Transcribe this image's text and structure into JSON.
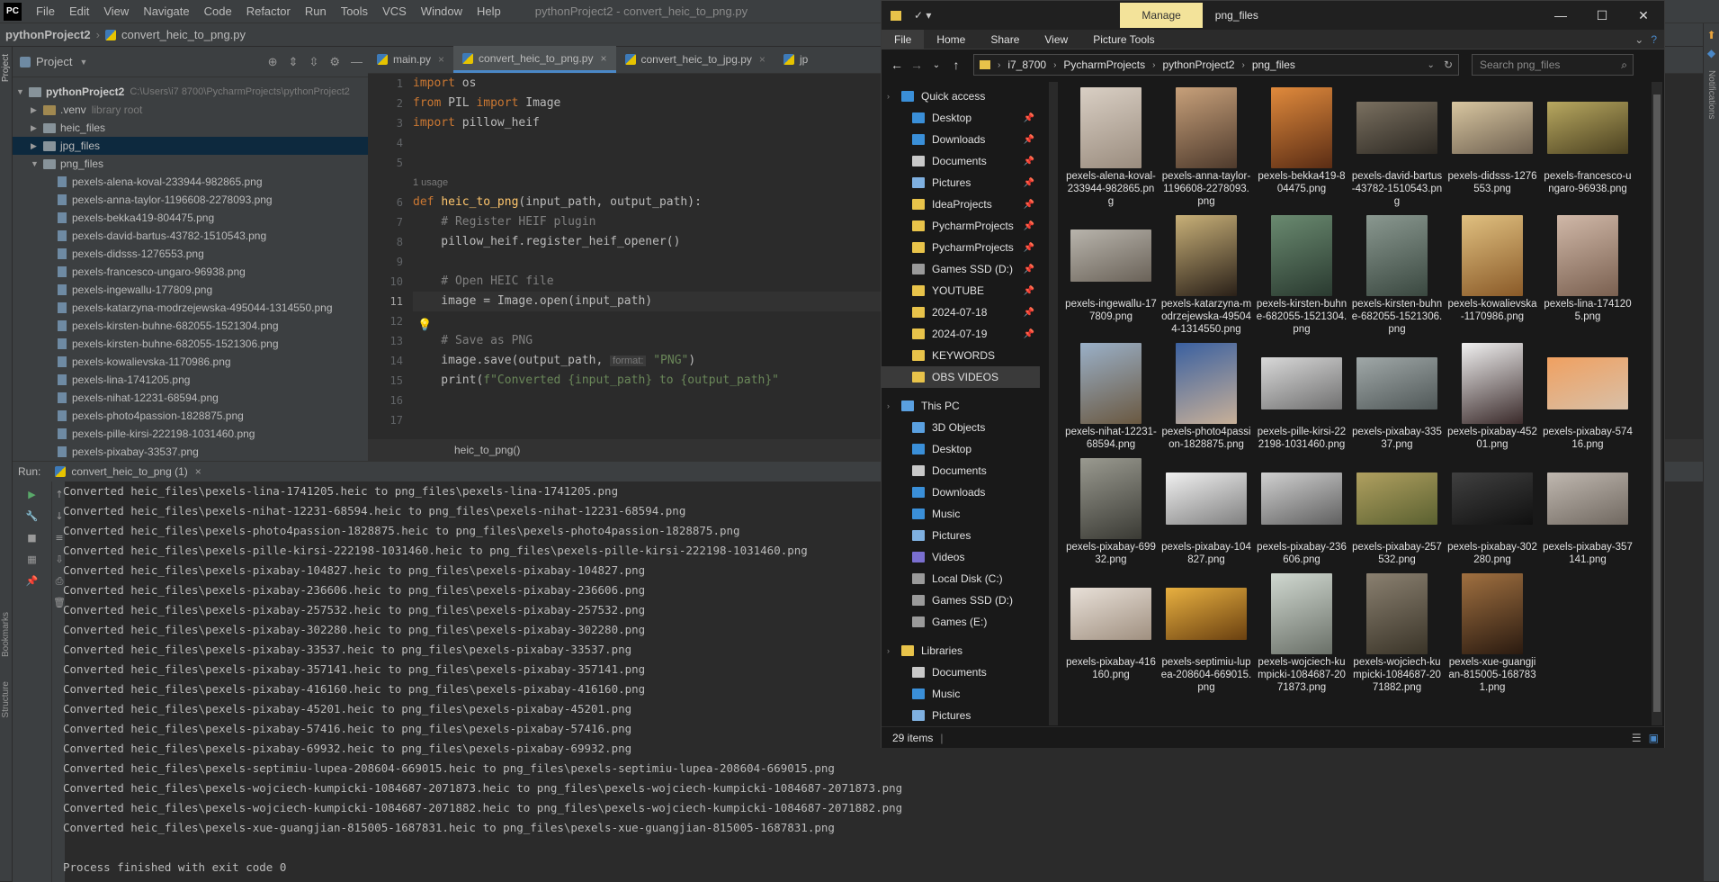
{
  "ide": {
    "logo": "PC",
    "menu": [
      "File",
      "Edit",
      "View",
      "Navigate",
      "Code",
      "Refactor",
      "Run",
      "Tools",
      "VCS",
      "Window",
      "Help"
    ],
    "window_title": "pythonProject2 - convert_heic_to_png.py",
    "breadcrumb": [
      "pythonProject2",
      "convert_heic_to_png.py"
    ],
    "project_panel": {
      "title": "Project",
      "root": "pythonProject2",
      "root_path": "C:\\Users\\i7 8700\\PycharmProjects\\pythonProject2",
      "folders": [
        {
          "name": ".venv",
          "hint": "library root"
        },
        {
          "name": "heic_files",
          "hint": ""
        },
        {
          "name": "jpg_files",
          "hint": ""
        },
        {
          "name": "png_files",
          "hint": ""
        }
      ],
      "files": [
        "pexels-alena-koval-233944-982865.png",
        "pexels-anna-taylor-1196608-2278093.png",
        "pexels-bekka419-804475.png",
        "pexels-david-bartus-43782-1510543.png",
        "pexels-didsss-1276553.png",
        "pexels-francesco-ungaro-96938.png",
        "pexels-ingewallu-177809.png",
        "pexels-katarzyna-modrzejewska-495044-1314550.png",
        "pexels-kirsten-buhne-682055-1521304.png",
        "pexels-kirsten-buhne-682055-1521306.png",
        "pexels-kowalievska-1170986.png",
        "pexels-lina-1741205.png",
        "pexels-nihat-12231-68594.png",
        "pexels-photo4passion-1828875.png",
        "pexels-pille-kirsi-222198-1031460.png",
        "pexels-pixabay-33537.png"
      ]
    },
    "editor": {
      "tabs": [
        "main.py",
        "convert_heic_to_png.py",
        "convert_heic_to_jpg.py",
        "jp"
      ],
      "line_numbers": [
        "1",
        "2",
        "3",
        "4",
        "5",
        "6",
        "7",
        "8",
        "9",
        "10",
        "11",
        "12",
        "13",
        "14",
        "15",
        "16",
        "17"
      ],
      "code": {
        "l1_kw": "import",
        "l1_rest": " os",
        "l2_kw1": "from",
        "l2_mid": " PIL ",
        "l2_kw2": "import",
        "l2_rest": " Image",
        "l3_kw": "import",
        "l3_rest": " pillow_heif",
        "usage": "1 usage",
        "l6_kw": "def",
        "l6_fn": "heic_to_png",
        "l6_rest": "(input_path, output_path):",
        "l7": "    # Register HEIF plugin",
        "l8": "    pillow_heif.register_heif_opener()",
        "l10": "    # Open HEIC file",
        "l11": "    image = Image.open(input_path)",
        "l13": "    # Save as PNG",
        "l14_a": "    image.save(output_path, ",
        "l14_hint": "format:",
        "l14_str": " \"PNG\"",
        "l14_end": ")",
        "l15_a": "    print(",
        "l15_str": "f\"Converted {input_path} to {output_path}\""
      },
      "footer_crumb": "heic_to_png()"
    },
    "run": {
      "label": "Run:",
      "tab": "convert_heic_to_png (1)",
      "lines": [
        "Converted heic_files\\pexels-lina-1741205.heic to png_files\\pexels-lina-1741205.png",
        "Converted heic_files\\pexels-nihat-12231-68594.heic to png_files\\pexels-nihat-12231-68594.png",
        "Converted heic_files\\pexels-photo4passion-1828875.heic to png_files\\pexels-photo4passion-1828875.png",
        "Converted heic_files\\pexels-pille-kirsi-222198-1031460.heic to png_files\\pexels-pille-kirsi-222198-1031460.png",
        "Converted heic_files\\pexels-pixabay-104827.heic to png_files\\pexels-pixabay-104827.png",
        "Converted heic_files\\pexels-pixabay-236606.heic to png_files\\pexels-pixabay-236606.png",
        "Converted heic_files\\pexels-pixabay-257532.heic to png_files\\pexels-pixabay-257532.png",
        "Converted heic_files\\pexels-pixabay-302280.heic to png_files\\pexels-pixabay-302280.png",
        "Converted heic_files\\pexels-pixabay-33537.heic to png_files\\pexels-pixabay-33537.png",
        "Converted heic_files\\pexels-pixabay-357141.heic to png_files\\pexels-pixabay-357141.png",
        "Converted heic_files\\pexels-pixabay-416160.heic to png_files\\pexels-pixabay-416160.png",
        "Converted heic_files\\pexels-pixabay-45201.heic to png_files\\pexels-pixabay-45201.png",
        "Converted heic_files\\pexels-pixabay-57416.heic to png_files\\pexels-pixabay-57416.png",
        "Converted heic_files\\pexels-pixabay-69932.heic to png_files\\pexels-pixabay-69932.png",
        "Converted heic_files\\pexels-septimiu-lupea-208604-669015.heic to png_files\\pexels-septimiu-lupea-208604-669015.png",
        "Converted heic_files\\pexels-wojciech-kumpicki-1084687-2071873.heic to png_files\\pexels-wojciech-kumpicki-1084687-2071873.png",
        "Converted heic_files\\pexels-wojciech-kumpicki-1084687-2071882.heic to png_files\\pexels-wojciech-kumpicki-1084687-2071882.png",
        "Converted heic_files\\pexels-xue-guangjian-815005-1687831.heic to png_files\\pexels-xue-guangjian-815005-1687831.png",
        "",
        "Process finished with exit code 0"
      ]
    },
    "side_labels": {
      "project": "Project",
      "bookmarks": "Bookmarks",
      "structure": "Structure",
      "notifications": "Notifications"
    }
  },
  "explorer": {
    "manage": "Manage",
    "title": "png_files",
    "ribbon_tabs": [
      "File",
      "Home",
      "Share",
      "View",
      "Picture Tools"
    ],
    "address": [
      "i7_8700",
      "PycharmProjects",
      "pythonProject2",
      "png_files"
    ],
    "search_placeholder": "Search png_files",
    "nav": {
      "quick_access": "Quick access",
      "quick_items": [
        "Desktop",
        "Downloads",
        "Documents",
        "Pictures",
        "IdeaProjects",
        "PycharmProjects",
        "PycharmProjects",
        "Games SSD (D:)",
        "YOUTUBE",
        "2024-07-18",
        "2024-07-19",
        "KEYWORDS",
        "OBS VIDEOS"
      ],
      "this_pc": "This PC",
      "pc_items": [
        "3D Objects",
        "Desktop",
        "Documents",
        "Downloads",
        "Music",
        "Pictures",
        "Videos",
        "Local Disk (C:)",
        "Games SSD (D:)",
        "Games (E:)"
      ],
      "libraries": "Libraries",
      "lib_items": [
        "Documents",
        "Music",
        "Pictures"
      ]
    },
    "thumbnails": [
      {
        "label": "pexels-alena-koval-233944-982865.png",
        "c1": "#d9cfc4",
        "c2": "#9a8c7e",
        "shape": "tall"
      },
      {
        "label": "pexels-anna-taylor-1196608-2278093.png",
        "c1": "#c7a07a",
        "c2": "#4e3a2c",
        "shape": "tall"
      },
      {
        "label": "pexels-bekka419-804475.png",
        "c1": "#e08a3c",
        "c2": "#5a2c14",
        "shape": "tall"
      },
      {
        "label": "pexels-david-bartus-43782-1510543.png",
        "c1": "#7a7060",
        "c2": "#2c2822",
        "shape": "wide"
      },
      {
        "label": "pexels-didsss-1276553.png",
        "c1": "#d8c6a0",
        "c2": "#6e6050",
        "shape": "wide"
      },
      {
        "label": "pexels-francesco-ungaro-96938.png",
        "c1": "#b8a860",
        "c2": "#4a4020",
        "shape": "wide"
      },
      {
        "label": "pexels-ingewallu-177809.png",
        "c1": "#b8b4ac",
        "c2": "#6a6258",
        "shape": "wide"
      },
      {
        "label": "pexels-katarzyna-modrzejewska-495044-1314550.png",
        "c1": "#c8b078",
        "c2": "#2a2018",
        "shape": "tall"
      },
      {
        "label": "pexels-kirsten-buhne-682055-1521304.png",
        "c1": "#6a8a70",
        "c2": "#2a3a30",
        "shape": "tall"
      },
      {
        "label": "pexels-kirsten-buhne-682055-1521306.png",
        "c1": "#8a9890",
        "c2": "#3a4840",
        "shape": "tall"
      },
      {
        "label": "pexels-kowalievska-1170986.png",
        "c1": "#e0c080",
        "c2": "#8a5a28",
        "shape": "tall"
      },
      {
        "label": "pexels-lina-1741205.png",
        "c1": "#d0b8a8",
        "c2": "#7a6050",
        "shape": "tall"
      },
      {
        "label": "pexels-nihat-12231-68594.png",
        "c1": "#9ab0c8",
        "c2": "#6a5840",
        "shape": "tall"
      },
      {
        "label": "pexels-photo4passion-1828875.png",
        "c1": "#3a60a0",
        "c2": "#c8b098",
        "shape": "tall"
      },
      {
        "label": "pexels-pille-kirsi-222198-1031460.png",
        "c1": "#d8d8d8",
        "c2": "#707070",
        "shape": "wide"
      },
      {
        "label": "pexels-pixabay-33537.png",
        "c1": "#a0a8a8",
        "c2": "#505858",
        "shape": "wide"
      },
      {
        "label": "pexels-pixabay-45201.png",
        "c1": "#f0f0f0",
        "c2": "#3a2a2a",
        "shape": "tall"
      },
      {
        "label": "pexels-pixabay-57416.png",
        "c1": "#f0a060",
        "c2": "#d8c0a8",
        "shape": "wide"
      },
      {
        "label": "pexels-pixabay-69932.png",
        "c1": "#9a9a90",
        "c2": "#3a3a34",
        "shape": "tall"
      },
      {
        "label": "pexels-pixabay-104827.png",
        "c1": "#f0f0f0",
        "c2": "#808080",
        "shape": "wide"
      },
      {
        "label": "pexels-pixabay-236606.png",
        "c1": "#d0d0d0",
        "c2": "#606060",
        "shape": "wide"
      },
      {
        "label": "pexels-pixabay-257532.png",
        "c1": "#b0a060",
        "c2": "#5a6030",
        "shape": "wide"
      },
      {
        "label": "pexels-pixabay-302280.png",
        "c1": "#404040",
        "c2": "#101010",
        "shape": "wide"
      },
      {
        "label": "pexels-pixabay-357141.png",
        "c1": "#c0b8b0",
        "c2": "#706860",
        "shape": "wide"
      },
      {
        "label": "pexels-pixabay-416160.png",
        "c1": "#e8e0d8",
        "c2": "#a09080",
        "shape": "wide"
      },
      {
        "label": "pexels-septimiu-lupea-208604-669015.png",
        "c1": "#e8b040",
        "c2": "#6a4010",
        "shape": "wide"
      },
      {
        "label": "pexels-wojciech-kumpicki-1084687-2071873.png",
        "c1": "#d0d8d0",
        "c2": "#6a7068",
        "shape": "tall"
      },
      {
        "label": "pexels-wojciech-kumpicki-1084687-2071882.png",
        "c1": "#8a8070",
        "c2": "#3a3428",
        "shape": "tall"
      },
      {
        "label": "pexels-xue-guangjian-815005-1687831.png",
        "c1": "#a07040",
        "c2": "#2a1a10",
        "shape": "tall"
      }
    ],
    "status": "29 items"
  }
}
